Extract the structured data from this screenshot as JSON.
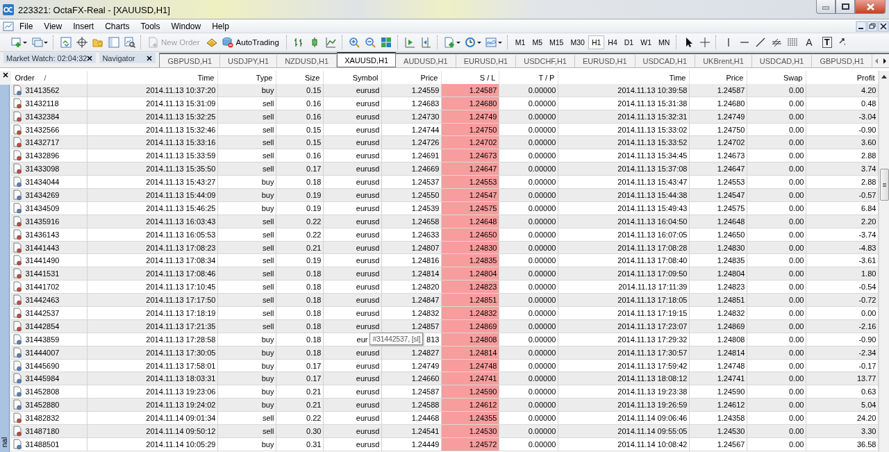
{
  "window": {
    "title": "223321: OctaFX-Real - [XAUUSD,H1]"
  },
  "menu": [
    {
      "label": "File"
    },
    {
      "label": "View"
    },
    {
      "label": "Insert"
    },
    {
      "label": "Charts"
    },
    {
      "label": "Tools"
    },
    {
      "label": "Window"
    },
    {
      "label": "Help"
    }
  ],
  "toolbar": {
    "new_order": {
      "label": "New Order",
      "disabled": true
    },
    "auto_trading": {
      "label": "AutoTrading"
    },
    "timeframes": [
      {
        "label": "M1",
        "selected": false
      },
      {
        "label": "M5",
        "selected": false
      },
      {
        "label": "M15",
        "selected": false
      },
      {
        "label": "M30",
        "selected": false
      },
      {
        "label": "H1",
        "selected": true
      },
      {
        "label": "H4",
        "selected": false
      },
      {
        "label": "D1",
        "selected": false
      },
      {
        "label": "W1",
        "selected": false
      },
      {
        "label": "MN",
        "selected": false
      }
    ],
    "text_tool": "A",
    "label_tool": "T"
  },
  "panels": [
    {
      "title": "Market Watch: 02:04:32"
    },
    {
      "title": "Navigator"
    }
  ],
  "chart_tabs": [
    {
      "label": "GBPUSD,H1",
      "selected": false
    },
    {
      "label": "USDJPY,H1",
      "selected": false
    },
    {
      "label": "NZDUSD,H1",
      "selected": false
    },
    {
      "label": "XAUUSD,H1",
      "selected": true
    },
    {
      "label": "AUDUSD,H1",
      "selected": false
    },
    {
      "label": "EURUSD,H1",
      "selected": false
    },
    {
      "label": "USDCHF,H1",
      "selected": false
    },
    {
      "label": "EURUSD,H1",
      "selected": false
    },
    {
      "label": "USDCAD,H1",
      "selected": false
    },
    {
      "label": "UKBrent,H1",
      "selected": false
    },
    {
      "label": "USDCAD,H1",
      "selected": false
    },
    {
      "label": "GBPUSD,H1",
      "selected": false
    }
  ],
  "terminal": {
    "side_label": "nal"
  },
  "table": {
    "columns": [
      {
        "label": "Order",
        "sort_mark": "/",
        "highlighted": false
      },
      {
        "label": "Time",
        "highlighted": false
      },
      {
        "label": "Type",
        "highlighted": false
      },
      {
        "label": "Size",
        "highlighted": false
      },
      {
        "label": "Symbol",
        "highlighted": false
      },
      {
        "label": "Price",
        "highlighted": false
      },
      {
        "label": "S / L",
        "highlighted": true
      },
      {
        "label": "T / P",
        "highlighted": false
      },
      {
        "label": "Time",
        "highlighted": false
      },
      {
        "label": "Price",
        "highlighted": false
      },
      {
        "label": "Swap",
        "highlighted": false
      },
      {
        "label": "Profit",
        "highlighted": false
      }
    ],
    "rows": [
      {
        "kind": "buy",
        "cells": [
          "31413562",
          "2014.11.13 10:37:20",
          "buy",
          "0.15",
          "eurusd",
          "1.24559",
          "1.24587",
          "0.00000",
          "2014.11.13 10:39:58",
          "1.24587",
          "0.00",
          "4.20"
        ]
      },
      {
        "kind": "sell",
        "cells": [
          "31432118",
          "2014.11.13 15:31:09",
          "sell",
          "0.16",
          "eurusd",
          "1.24683",
          "1.24680",
          "0.00000",
          "2014.11.13 15:31:38",
          "1.24680",
          "0.00",
          "0.48"
        ]
      },
      {
        "kind": "sell",
        "cells": [
          "31432384",
          "2014.11.13 15:32:25",
          "sell",
          "0.16",
          "eurusd",
          "1.24730",
          "1.24749",
          "0.00000",
          "2014.11.13 15:32:31",
          "1.24749",
          "0.00",
          "-3.04"
        ]
      },
      {
        "kind": "sell",
        "cells": [
          "31432566",
          "2014.11.13 15:32:46",
          "sell",
          "0.15",
          "eurusd",
          "1.24744",
          "1.24750",
          "0.00000",
          "2014.11.13 15:33:02",
          "1.24750",
          "0.00",
          "-0.90"
        ]
      },
      {
        "kind": "sell",
        "cells": [
          "31432717",
          "2014.11.13 15:33:16",
          "sell",
          "0.15",
          "eurusd",
          "1.24726",
          "1.24702",
          "0.00000",
          "2014.11.13 15:33:52",
          "1.24702",
          "0.00",
          "3.60"
        ]
      },
      {
        "kind": "sell",
        "cells": [
          "31432896",
          "2014.11.13 15:33:59",
          "sell",
          "0.16",
          "eurusd",
          "1.24691",
          "1.24673",
          "0.00000",
          "2014.11.13 15:34:45",
          "1.24673",
          "0.00",
          "2.88"
        ]
      },
      {
        "kind": "sell",
        "cells": [
          "31433098",
          "2014.11.13 15:35:50",
          "sell",
          "0.17",
          "eurusd",
          "1.24669",
          "1.24647",
          "0.00000",
          "2014.11.13 15:37:08",
          "1.24647",
          "0.00",
          "3.74"
        ]
      },
      {
        "kind": "buy",
        "cells": [
          "31434044",
          "2014.11.13 15:43:27",
          "buy",
          "0.18",
          "eurusd",
          "1.24537",
          "1.24553",
          "0.00000",
          "2014.11.13 15:43:47",
          "1.24553",
          "0.00",
          "2.88"
        ]
      },
      {
        "kind": "buy",
        "cells": [
          "31434269",
          "2014.11.13 15:44:09",
          "buy",
          "0.19",
          "eurusd",
          "1.24550",
          "1.24547",
          "0.00000",
          "2014.11.13 15:44:38",
          "1.24547",
          "0.00",
          "-0.57"
        ]
      },
      {
        "kind": "buy",
        "cells": [
          "31434509",
          "2014.11.13 15:46:25",
          "buy",
          "0.19",
          "eurusd",
          "1.24539",
          "1.24575",
          "0.00000",
          "2014.11.13 15:49:43",
          "1.24575",
          "0.00",
          "6.84"
        ]
      },
      {
        "kind": "sell",
        "cells": [
          "31435916",
          "2014.11.13 16:03:43",
          "sell",
          "0.22",
          "eurusd",
          "1.24658",
          "1.24648",
          "0.00000",
          "2014.11.13 16:04:50",
          "1.24648",
          "0.00",
          "2.20"
        ]
      },
      {
        "kind": "sell",
        "cells": [
          "31436143",
          "2014.11.13 16:05:53",
          "sell",
          "0.22",
          "eurusd",
          "1.24633",
          "1.24650",
          "0.00000",
          "2014.11.13 16:07:05",
          "1.24650",
          "0.00",
          "-3.74"
        ]
      },
      {
        "kind": "sell",
        "cells": [
          "31441443",
          "2014.11.13 17:08:23",
          "sell",
          "0.21",
          "eurusd",
          "1.24807",
          "1.24830",
          "0.00000",
          "2014.11.13 17:08:28",
          "1.24830",
          "0.00",
          "-4.83"
        ]
      },
      {
        "kind": "sell",
        "cells": [
          "31441490",
          "2014.11.13 17:08:34",
          "sell",
          "0.19",
          "eurusd",
          "1.24816",
          "1.24835",
          "0.00000",
          "2014.11.13 17:08:40",
          "1.24835",
          "0.00",
          "-3.61"
        ]
      },
      {
        "kind": "sell",
        "cells": [
          "31441531",
          "2014.11.13 17:08:46",
          "sell",
          "0.18",
          "eurusd",
          "1.24814",
          "1.24804",
          "0.00000",
          "2014.11.13 17:09:50",
          "1.24804",
          "0.00",
          "1.80"
        ]
      },
      {
        "kind": "sell",
        "cells": [
          "31441702",
          "2014.11.13 17:10:45",
          "sell",
          "0.18",
          "eurusd",
          "1.24820",
          "1.24823",
          "0.00000",
          "2014.11.13 17:11:39",
          "1.24823",
          "0.00",
          "-0.54"
        ]
      },
      {
        "kind": "sell",
        "cells": [
          "31442463",
          "2014.11.13 17:17:50",
          "sell",
          "0.18",
          "eurusd",
          "1.24847",
          "1.24851",
          "0.00000",
          "2014.11.13 17:18:05",
          "1.24851",
          "0.00",
          "-0.72"
        ]
      },
      {
        "kind": "sell",
        "cells": [
          "31442537",
          "2014.11.13 17:18:19",
          "sell",
          "0.18",
          "eurusd",
          "1.24832",
          "1.24832",
          "0.00000",
          "2014.11.13 17:19:15",
          "1.24832",
          "0.00",
          "0.00"
        ]
      },
      {
        "kind": "sell",
        "cells": [
          "31442854",
          "2014.11.13 17:21:35",
          "sell",
          "0.18",
          "eurusd",
          "1.24857",
          "1.24869",
          "0.00000",
          "2014.11.13 17:23:07",
          "1.24869",
          "0.00",
          "-2.16"
        ]
      },
      {
        "kind": "buy",
        "cells": [
          "31443859",
          "2014.11.13 17:28:58",
          "buy",
          "0.18",
          "eur",
          "813",
          "1.24808",
          "0.00000",
          "2014.11.13 17:29:32",
          "1.24808",
          "0.00",
          "-0.90"
        ],
        "tooltip": {
          "text": "#31442537, [sl]"
        }
      },
      {
        "kind": "buy",
        "cells": [
          "31444007",
          "2014.11.13 17:30:05",
          "buy",
          "0.18",
          "eurusd",
          "1.24827",
          "1.24814",
          "0.00000",
          "2014.11.13 17:30:57",
          "1.24814",
          "0.00",
          "-2.34"
        ]
      },
      {
        "kind": "buy",
        "cells": [
          "31445690",
          "2014.11.13 17:58:01",
          "buy",
          "0.17",
          "eurusd",
          "1.24749",
          "1.24748",
          "0.00000",
          "2014.11.13 17:59:42",
          "1.24748",
          "0.00",
          "-0.17"
        ]
      },
      {
        "kind": "buy",
        "cells": [
          "31445984",
          "2014.11.13 18:03:31",
          "buy",
          "0.17",
          "eurusd",
          "1.24660",
          "1.24741",
          "0.00000",
          "2014.11.13 18:08:12",
          "1.24741",
          "0.00",
          "13.77"
        ]
      },
      {
        "kind": "buy",
        "cells": [
          "31452808",
          "2014.11.13 19:23:06",
          "buy",
          "0.21",
          "eurusd",
          "1.24587",
          "1.24590",
          "0.00000",
          "2014.11.13 19:23:38",
          "1.24590",
          "0.00",
          "0.63"
        ]
      },
      {
        "kind": "buy",
        "cells": [
          "31452880",
          "2014.11.13 19:24:02",
          "buy",
          "0.21",
          "eurusd",
          "1.24588",
          "1.24612",
          "0.00000",
          "2014.11.13 19:26:59",
          "1.24612",
          "0.00",
          "5.04"
        ]
      },
      {
        "kind": "sell",
        "cells": [
          "31482832",
          "2014.11.14 09:01:34",
          "sell",
          "0.22",
          "eurusd",
          "1.24468",
          "1.24355",
          "0.00000",
          "2014.11.14 09:06:46",
          "1.24358",
          "0.00",
          "24.20"
        ]
      },
      {
        "kind": "sell",
        "cells": [
          "31487180",
          "2014.11.14 09:50:12",
          "sell",
          "0.30",
          "eurusd",
          "1.24541",
          "1.24530",
          "0.00000",
          "2014.11.14 09:55:05",
          "1.24530",
          "0.00",
          "3.30"
        ]
      },
      {
        "kind": "buy",
        "cells": [
          "31488501",
          "2014.11.14 10:05:29",
          "buy",
          "0.31",
          "eurusd",
          "1.24449",
          "1.24572",
          "0.00000",
          "2014.11.14 10:08:42",
          "1.24567",
          "0.00",
          "36.58"
        ]
      }
    ]
  }
}
